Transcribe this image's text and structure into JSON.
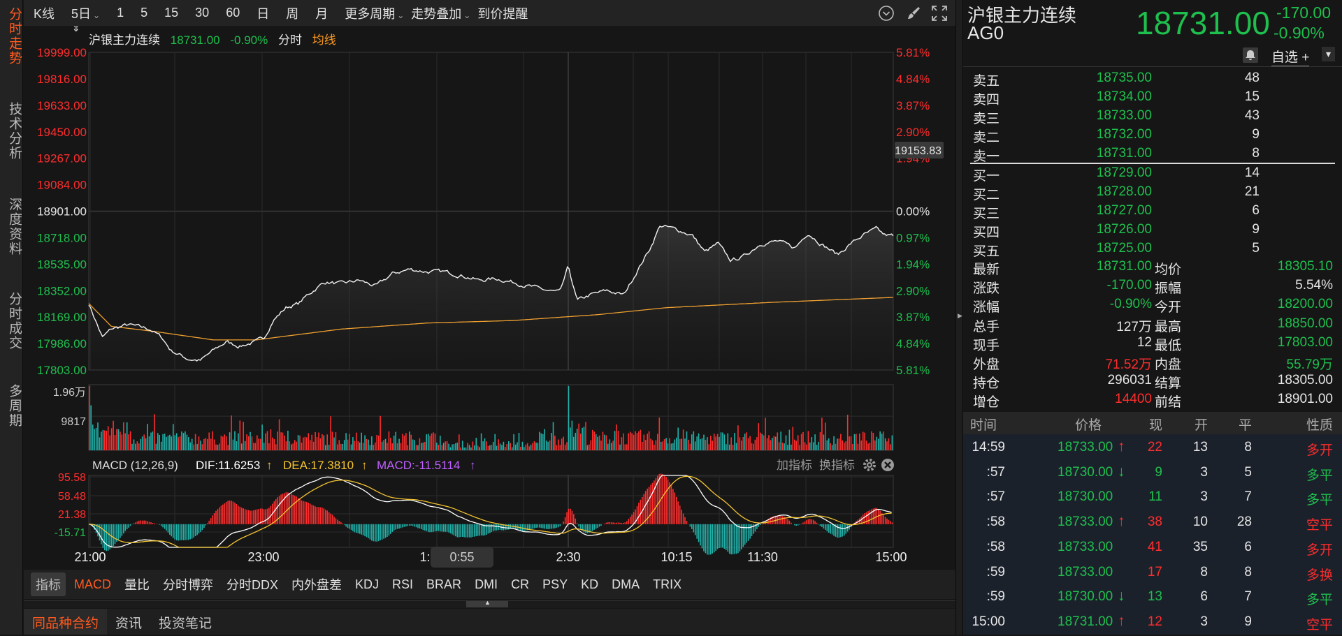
{
  "left_tabs": [
    {
      "label": "分时走势",
      "active": true
    },
    {
      "label": "技术分析"
    },
    {
      "label": "深度资料"
    },
    {
      "label": "分时成交"
    },
    {
      "label": "多周期"
    }
  ],
  "toolbar": {
    "items": [
      "K线",
      "5日",
      "1",
      "5",
      "15",
      "30",
      "60",
      "日",
      "周",
      "月"
    ],
    "more_period": "更多周期",
    "overlay": "走势叠加",
    "alert": "到价提醒"
  },
  "chart_title": {
    "name": "沪银主力连续",
    "price": "18731.00",
    "change_pct": "-0.90%",
    "mode": "分时",
    "avg_label": "均线"
  },
  "price_axis": {
    "left": [
      "19999.00",
      "19816.00",
      "19633.00",
      "19450.00",
      "19267.00",
      "19084.00",
      "18901.00",
      "18718.00",
      "18535.00",
      "18352.00",
      "18169.00",
      "17986.00",
      "17803.00"
    ],
    "right": [
      "5.81%",
      "4.84%",
      "3.87%",
      "2.90%",
      "1.94%",
      "0.97%",
      "0.00%",
      "0.97%",
      "1.94%",
      "2.90%",
      "3.87%",
      "4.84%",
      "5.81%"
    ],
    "crosshair_value": "19153.83"
  },
  "volume_axis": [
    "1.96万",
    "9817"
  ],
  "macd": {
    "label": "MACD (12,26,9)",
    "dif": "DIF:11.6253",
    "dea": "DEA:17.3810",
    "macd": "MACD:-11.5114",
    "arrow": "↑",
    "add_indicator": "加指标",
    "switch_indicator": "换指标",
    "axis": [
      "95.58",
      "58.48",
      "21.38",
      "-15.71"
    ]
  },
  "time_axis": [
    "21:00",
    "23:00",
    "1:00",
    "2:30",
    "10:15",
    "11:30",
    "15:00"
  ],
  "time_cursor": "0:55",
  "indicator_tabs": [
    "指标",
    "MACD",
    "量比",
    "分时博弈",
    "分时DDX",
    "内外盘差",
    "KDJ",
    "RSI",
    "BRAR",
    "DMI",
    "CR",
    "PSY",
    "KD",
    "DMA",
    "TRIX"
  ],
  "bottom_tabs": [
    "同品种合约",
    "资讯",
    "投资笔记"
  ],
  "colors": {
    "up": "#ff2d2d",
    "down": "#1fbf4e",
    "avg": "#f0a030",
    "accent": "#ff5a1f",
    "dif": "#ffffff",
    "dea": "#f5c531",
    "macd": "#c060ff"
  },
  "chart_data": {
    "type": "line",
    "prev_close": 18901,
    "ylim": [
      17803,
      19999
    ],
    "x_range": [
      0,
      1000
    ],
    "price": [
      [
        0,
        18263
      ],
      [
        17,
        18027
      ],
      [
        28,
        18086
      ],
      [
        49,
        18116
      ],
      [
        76,
        18086
      ],
      [
        91,
        18027
      ],
      [
        102,
        17939
      ],
      [
        123,
        17880
      ],
      [
        139,
        17868
      ],
      [
        155,
        17939
      ],
      [
        171,
        17998
      ],
      [
        187,
        17968
      ],
      [
        208,
        17998
      ],
      [
        218,
        18027
      ],
      [
        229,
        18145
      ],
      [
        245,
        18234
      ],
      [
        261,
        18263
      ],
      [
        272,
        18322
      ],
      [
        293,
        18411
      ],
      [
        314,
        18399
      ],
      [
        336,
        18423
      ],
      [
        357,
        18382
      ],
      [
        378,
        18470
      ],
      [
        399,
        18500
      ],
      [
        421,
        18482
      ],
      [
        442,
        18482
      ],
      [
        463,
        18458
      ],
      [
        485,
        18423
      ],
      [
        506,
        18435
      ],
      [
        527,
        18411
      ],
      [
        548,
        18382
      ],
      [
        570,
        18352
      ],
      [
        586,
        18340
      ],
      [
        596,
        18517
      ],
      [
        607,
        18281
      ],
      [
        623,
        18322
      ],
      [
        644,
        18352
      ],
      [
        665,
        18322
      ],
      [
        681,
        18482
      ],
      [
        698,
        18647
      ],
      [
        710,
        18801
      ],
      [
        729,
        18777
      ],
      [
        750,
        18736
      ],
      [
        766,
        18618
      ],
      [
        782,
        18677
      ],
      [
        798,
        18559
      ],
      [
        814,
        18588
      ],
      [
        835,
        18677
      ],
      [
        856,
        18694
      ],
      [
        878,
        18647
      ],
      [
        894,
        18753
      ],
      [
        910,
        18677
      ],
      [
        931,
        18600
      ],
      [
        947,
        18677
      ],
      [
        963,
        18736
      ],
      [
        979,
        18777
      ],
      [
        989,
        18736
      ],
      [
        1000,
        18731
      ]
    ],
    "avg": [
      [
        0,
        18263
      ],
      [
        28,
        18105
      ],
      [
        81,
        18070
      ],
      [
        155,
        18011
      ],
      [
        208,
        18011
      ],
      [
        314,
        18086
      ],
      [
        421,
        18128
      ],
      [
        527,
        18145
      ],
      [
        633,
        18186
      ],
      [
        718,
        18234
      ],
      [
        846,
        18270
      ],
      [
        1000,
        18305
      ]
    ]
  },
  "quote": {
    "name": "沪银主力连续",
    "code": "AG0",
    "price": "18731.00",
    "change": "-170.00",
    "change_pct": "-0.90%",
    "watch_btn": "自选 +",
    "dropdown": "▾"
  },
  "order_book": {
    "asks": [
      {
        "label": "卖五",
        "price": "18735.00",
        "vol": "48"
      },
      {
        "label": "卖四",
        "price": "18734.00",
        "vol": "15"
      },
      {
        "label": "卖三",
        "price": "18733.00",
        "vol": "43"
      },
      {
        "label": "卖二",
        "price": "18732.00",
        "vol": "9"
      },
      {
        "label": "卖一",
        "price": "18731.00",
        "vol": "8"
      }
    ],
    "bids": [
      {
        "label": "买一",
        "price": "18729.00",
        "vol": "14"
      },
      {
        "label": "买二",
        "price": "18728.00",
        "vol": "21"
      },
      {
        "label": "买三",
        "price": "18727.00",
        "vol": "6"
      },
      {
        "label": "买四",
        "price": "18726.00",
        "vol": "9"
      },
      {
        "label": "买五",
        "price": "18725.00",
        "vol": "5"
      }
    ]
  },
  "stats": [
    {
      "l1": "最新",
      "v1": "18731.00",
      "c1": "g",
      "l2": "均价",
      "v2": "18305.10",
      "c2": "g"
    },
    {
      "l1": "涨跌",
      "v1": "-170.00",
      "c1": "g",
      "l2": "振幅",
      "v2": "5.54%",
      "c2": "w"
    },
    {
      "l1": "涨幅",
      "v1": "-0.90%",
      "c1": "g",
      "l2": "今开",
      "v2": "18200.00",
      "c2": "g"
    },
    {
      "l1": "总手",
      "v1": "127万",
      "c1": "w",
      "l2": "最高",
      "v2": "18850.00",
      "c2": "g"
    },
    {
      "l1": "现手",
      "v1": "12",
      "c1": "w",
      "l2": "最低",
      "v2": "17803.00",
      "c2": "g"
    },
    {
      "l1": "外盘",
      "v1": "71.52万",
      "c1": "r",
      "l2": "内盘",
      "v2": "55.79万",
      "c2": "g"
    },
    {
      "l1": "持仓",
      "v1": "296031",
      "c1": "w",
      "l2": "结算",
      "v2": "18305.00",
      "c2": "w"
    },
    {
      "l1": "增仓",
      "v1": "14400",
      "c1": "r",
      "l2": "前结",
      "v2": "18901.00",
      "c2": "w"
    }
  ],
  "trades": {
    "headers": [
      "时间",
      "价格",
      "现",
      "开",
      "平",
      "性质"
    ],
    "rows": [
      {
        "time": "14:59",
        "price": "18733.00",
        "dir": "up",
        "now": "22",
        "nc": "r",
        "open": "13",
        "close": "8",
        "type": "多开",
        "tc": "r"
      },
      {
        "time": ":57",
        "price": "18730.00",
        "dir": "down",
        "now": "9",
        "nc": "g",
        "open": "3",
        "close": "5",
        "type": "多平",
        "tc": "g"
      },
      {
        "time": ":57",
        "price": "18730.00",
        "dir": "",
        "now": "11",
        "nc": "g",
        "open": "3",
        "close": "7",
        "type": "多平",
        "tc": "g"
      },
      {
        "time": ":58",
        "price": "18733.00",
        "dir": "up",
        "now": "38",
        "nc": "r",
        "open": "10",
        "close": "28",
        "type": "空平",
        "tc": "r"
      },
      {
        "time": ":58",
        "price": "18733.00",
        "dir": "",
        "now": "41",
        "nc": "r",
        "open": "35",
        "close": "6",
        "type": "多开",
        "tc": "r"
      },
      {
        "time": ":59",
        "price": "18733.00",
        "dir": "",
        "now": "17",
        "nc": "r",
        "open": "8",
        "close": "8",
        "type": "多换",
        "tc": "r"
      },
      {
        "time": ":59",
        "price": "18730.00",
        "dir": "down",
        "now": "13",
        "nc": "g",
        "open": "6",
        "close": "7",
        "type": "多平",
        "tc": "g"
      },
      {
        "time": "15:00",
        "price": "18731.00",
        "dir": "up",
        "now": "12",
        "nc": "r",
        "open": "3",
        "close": "9",
        "type": "空平",
        "tc": "r"
      }
    ]
  }
}
